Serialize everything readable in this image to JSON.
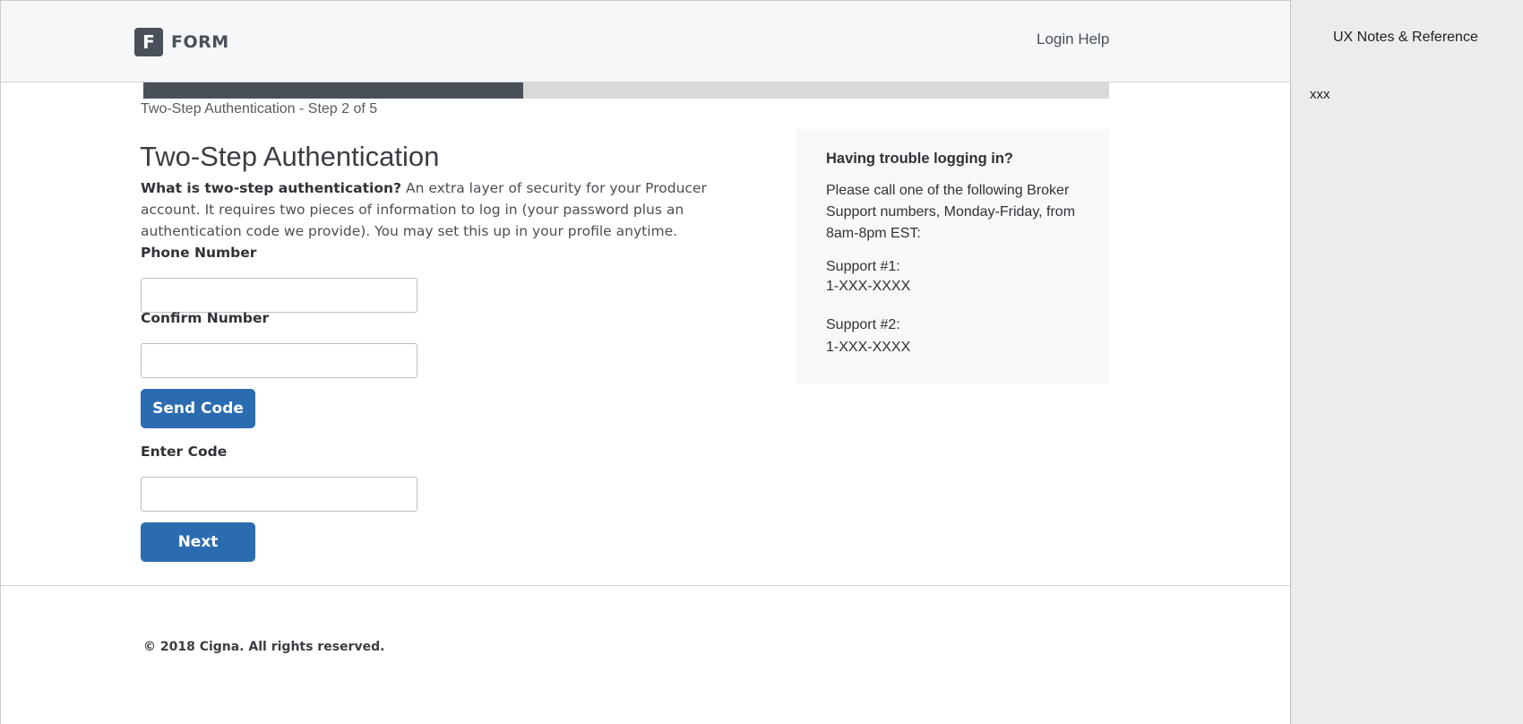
{
  "header": {
    "logo_letter": "F",
    "logo_text": "FORM",
    "login_help": "Login Help"
  },
  "progress": {
    "step_label": "Two-Step Authentication - Step 2 of 5",
    "fraction": 0.393
  },
  "main": {
    "title": "Two-Step Authentication",
    "intro_bold": "What is two-step authentication?",
    "intro_text": " An extra layer of security for your Producer account. It requires two pieces of information to log in (your password plus an authentication code we provide). You may set this up in your profile anytime.",
    "phone_label": "Phone Number",
    "phone_value": "",
    "confirm_label": "Confirm Number",
    "confirm_value": "",
    "send_code_label": "Send Code",
    "enter_code_label": "Enter Code",
    "code_value": "",
    "next_label": "Next"
  },
  "help": {
    "title": "Having trouble logging in?",
    "text": "Please call one of the following Broker Support numbers, Monday-Friday, from 8am-8pm EST:",
    "support1_label": "Support #1:",
    "support1_number": "1-XXX-XXXX",
    "support2_label": "Support #2:",
    "support2_number": "1-XXX-XXXX"
  },
  "footer": {
    "copyright": "© 2018 Cigna. All rights reserved."
  },
  "notes": {
    "title": "UX Notes & Reference",
    "body": "xxx"
  },
  "colors": {
    "primary_button": "#2b6cb0",
    "progress_fill": "#4a505a",
    "progress_track": "#d8d9da"
  }
}
